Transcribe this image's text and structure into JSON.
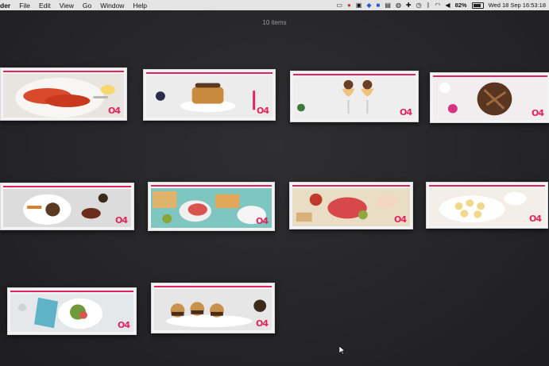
{
  "menubar": {
    "app_menu": "der",
    "items": [
      "File",
      "Edit",
      "View",
      "Go",
      "Window",
      "Help"
    ],
    "battery": "82%",
    "datetime": "Wed 18 Sep  16:53:18"
  },
  "window": {
    "item_count": "10 items"
  },
  "tiles": [
    {
      "logo": "O4",
      "subject": "lobster"
    },
    {
      "logo": "O4",
      "subject": "pancakes"
    },
    {
      "logo": "O4",
      "subject": "dessert glasses"
    },
    {
      "logo": "O4",
      "subject": "chocolate tart"
    },
    {
      "logo": "O4",
      "subject": "plated meat"
    },
    {
      "logo": "O4",
      "subject": "antipasti board"
    },
    {
      "logo": "O4",
      "subject": "charcuterie board"
    },
    {
      "logo": "O4",
      "subject": "piped canapes"
    },
    {
      "logo": "O4",
      "subject": "salad"
    },
    {
      "logo": "O4",
      "subject": "sliders"
    }
  ],
  "colors": {
    "brand": "#e0245e",
    "desktop": "#262628",
    "menubar": "#e4e4e4"
  }
}
